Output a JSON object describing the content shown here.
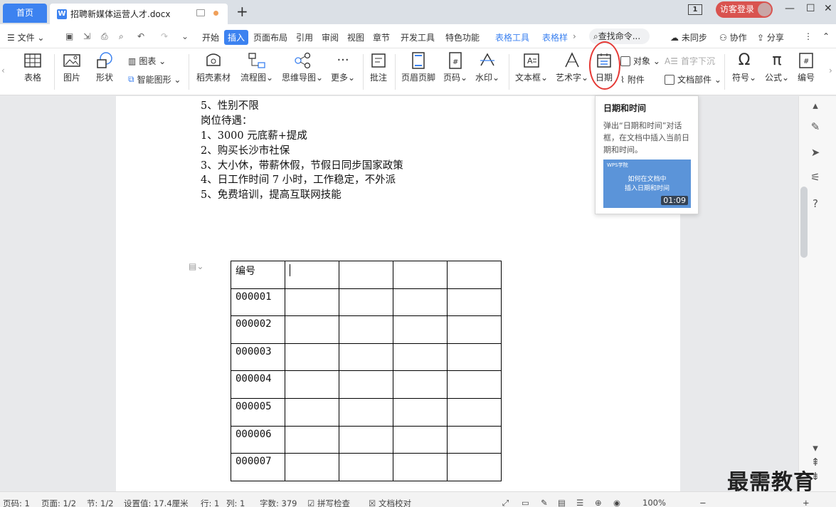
{
  "tabs": {
    "home": "首页",
    "document": "招聘新媒体运营人才.docx",
    "new_tab": "+",
    "window_number": "1",
    "login": "访客登录"
  },
  "menu": {
    "file": "文件",
    "items": [
      "开始",
      "插入",
      "页面布局",
      "引用",
      "审阅",
      "视图",
      "章节",
      "开发工具",
      "特色功能",
      "表格工具",
      "表格样"
    ],
    "active": "插入",
    "search": "查找命令...",
    "sync": "未同步",
    "collab": "协作",
    "share": "分享"
  },
  "ribbon": {
    "table": "表格",
    "picture": "图片",
    "shape": "形状",
    "chart": "图表",
    "smart": "智能图形",
    "material": "稻壳素材",
    "flowchart": "流程图",
    "mindmap": "思维导图",
    "more": "更多",
    "comment": "批注",
    "header_footer": "页眉页脚",
    "page_number": "页码",
    "watermark": "水印",
    "textbox": "文本框",
    "wordart": "艺术字",
    "date": "日期",
    "object": "对象",
    "attachment": "附件",
    "dropcap": "首字下沉",
    "docpart": "文档部件",
    "symbol": "符号",
    "formula": "公式",
    "numbering": "编号"
  },
  "document": {
    "lines": [
      "5、性别不限",
      "岗位待遇：",
      "1、3000 元底薪+提成",
      "2、购买长沙市社保",
      "3、大小休，带薪休假，节假日同步国家政策",
      "4、日工作时间 7 小时，工作稳定，不外派",
      "5、免费培训，提高互联网技能"
    ],
    "table_header": "编号",
    "table_ids": [
      "000001",
      "000002",
      "000003",
      "000004",
      "000005",
      "000006",
      "000007"
    ]
  },
  "tooltip": {
    "title": "日期和时间",
    "description": "弹出“日期和时间”对话框，在文档中插入当前日期和时间。",
    "video_brand": "WPS学院",
    "video_title_1": "如何在文档中",
    "video_title_2": "插入日期和时间",
    "duration": "01:09"
  },
  "status": {
    "page_code": "页码: 1",
    "pages": "页面: 1/2",
    "section": "节: 1/2",
    "position": "设置值: 17.4厘米",
    "row": "行: 1",
    "col": "列: 1",
    "words": "字数: 379",
    "spell": "拼写检查",
    "doc_check": "文档校对",
    "zoom": "100%"
  },
  "watermark": "最需教育",
  "colors": {
    "accent": "#3c82f0",
    "login": "#d9534f",
    "highlight": "#e53935"
  }
}
